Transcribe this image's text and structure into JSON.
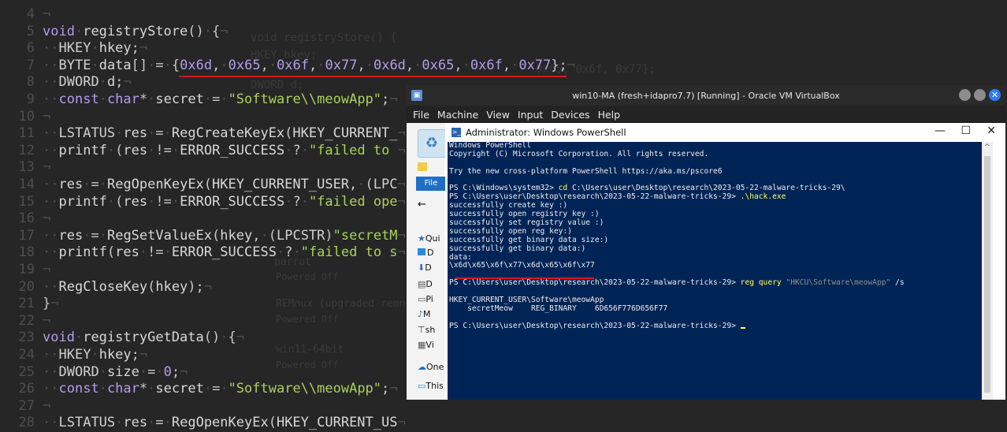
{
  "editor": {
    "lines": [
      {
        "n": "4",
        "code": ""
      },
      {
        "n": "5",
        "code": "void registryStore() {"
      },
      {
        "n": "6",
        "code": "  HKEY hkey;"
      },
      {
        "n": "7",
        "code": "  BYTE data[] = {0x6d, 0x65, 0x6f, 0x77, 0x6d, 0x65, 0x6f, 0x77};"
      },
      {
        "n": "8",
        "code": "  DWORD d;"
      },
      {
        "n": "9",
        "code": "  const char* secret = \"Software\\\\meowApp\";"
      },
      {
        "n": "10",
        "code": ""
      },
      {
        "n": "11",
        "code": "  LSTATUS res = RegCreateKeyEx(HKEY_CURRENT_"
      },
      {
        "n": "12",
        "code": "  printf (res != ERROR_SUCCESS ? \"failed to "
      },
      {
        "n": "13",
        "code": ""
      },
      {
        "n": "14",
        "code": "  res = RegOpenKeyEx(HKEY_CURRENT_USER, (LPC"
      },
      {
        "n": "15",
        "code": "  printf (res != ERROR_SUCCESS ? \"failed ope"
      },
      {
        "n": "16",
        "code": ""
      },
      {
        "n": "17",
        "code": "  res = RegSetValueEx(hkey, (LPCSTR)\"secretM"
      },
      {
        "n": "18",
        "code": "  printf(res != ERROR_SUCCESS ? \"failed to s"
      },
      {
        "n": "19",
        "code": ""
      },
      {
        "n": "20",
        "code": "  RegCloseKey(hkey);"
      },
      {
        "n": "21",
        "code": "}"
      },
      {
        "n": "22",
        "code": ""
      },
      {
        "n": "23",
        "code": "void registryGetData() {"
      },
      {
        "n": "24",
        "code": "  HKEY hkey;"
      },
      {
        "n": "25",
        "code": "  DWORD size = 0;"
      },
      {
        "n": "26",
        "code": "  const char* secret = \"Software\\\\meowApp\";"
      },
      {
        "n": "27",
        "code": ""
      },
      {
        "n": "28",
        "code": "  LSTATUS res = RegOpenKeyEx(HKEY_CURRENT_US"
      }
    ],
    "ghost": [
      {
        "text": "void registryStore() {"
      },
      {
        "text": "HKEY hkey;"
      },
      {
        "text": "0x65, 0x6f, 0x77};"
      },
      {
        "text": "DWORD d;"
      },
      {
        "text": "parrot"
      },
      {
        "text": "Powered Off"
      },
      {
        "text": "REMnux (upgraded remnux)"
      },
      {
        "text": "Powered Off"
      },
      {
        "text": "win11-64bit"
      },
      {
        "text": "Powered Off"
      }
    ]
  },
  "vbox": {
    "title": "win10-MA (fresh+idapro7.7) [Running] - Oracle VM VirtualBox",
    "menu": [
      "File",
      "Machine",
      "View",
      "Input",
      "Devices",
      "Help"
    ]
  },
  "explorer": {
    "file_tab": "File",
    "items": [
      "Qui",
      "D",
      "D",
      "D",
      "Pi",
      "M",
      "sh",
      "Vi",
      "One",
      "This"
    ]
  },
  "powershell": {
    "title": "Administrator: Windows PowerShell",
    "minimize": "—",
    "maximize": "☐",
    "close": "✕",
    "lines": [
      {
        "segs": [
          {
            "t": "Windows PowerShell",
            "c": "wh"
          }
        ]
      },
      {
        "segs": [
          {
            "t": "Copyright (C) Microsoft Corporation. All rights reserved.",
            "c": "wh"
          }
        ]
      },
      {
        "segs": [
          {
            "t": "",
            "c": "wh"
          }
        ]
      },
      {
        "segs": [
          {
            "t": "Try the new cross-platform PowerShell https://aka.ms/pscore6",
            "c": "wh"
          }
        ]
      },
      {
        "segs": [
          {
            "t": "",
            "c": "wh"
          }
        ]
      },
      {
        "segs": [
          {
            "t": "PS C:\\Windows\\system32> ",
            "c": "wh"
          },
          {
            "t": "cd",
            "c": "yel"
          },
          {
            "t": " C:\\Users\\user\\Desktop\\research\\2023-05-22-malware-tricks-29\\",
            "c": "wh"
          }
        ]
      },
      {
        "segs": [
          {
            "t": "PS C:\\Users\\user\\Desktop\\research\\2023-05-22-malware-tricks-29> ",
            "c": "wh"
          },
          {
            "t": ".\\hack.exe",
            "c": "yel"
          }
        ]
      },
      {
        "segs": [
          {
            "t": "successfully create key :)",
            "c": "wh"
          }
        ]
      },
      {
        "segs": [
          {
            "t": "successfully open registry key :)",
            "c": "wh"
          }
        ]
      },
      {
        "segs": [
          {
            "t": "successfully set registry value :)",
            "c": "wh"
          }
        ]
      },
      {
        "segs": [
          {
            "t": "successfully open reg key:)",
            "c": "wh"
          }
        ]
      },
      {
        "segs": [
          {
            "t": "successfully get binary data size:)",
            "c": "wh"
          }
        ]
      },
      {
        "segs": [
          {
            "t": "successfully get binary data:)",
            "c": "wh"
          }
        ]
      },
      {
        "segs": [
          {
            "t": "data:",
            "c": "wh"
          }
        ]
      },
      {
        "segs": [
          {
            "t": "\\x6d\\x65\\x6f\\x77\\x6d\\x65\\x6f\\x77",
            "c": "wh"
          }
        ]
      },
      {
        "segs": [
          {
            "t": "",
            "c": "wh"
          }
        ]
      },
      {
        "segs": [
          {
            "t": "PS C:\\Users\\user\\Desktop\\research\\2023-05-22-malware-tricks-29> ",
            "c": "wh"
          },
          {
            "t": "reg query",
            "c": "yel"
          },
          {
            "t": " \"HKCU\\Software\\meowApp\"",
            "c": "gry"
          },
          {
            "t": " /s",
            "c": "wh"
          }
        ]
      },
      {
        "segs": [
          {
            "t": "",
            "c": "wh"
          }
        ]
      },
      {
        "segs": [
          {
            "t": "HKEY_CURRENT_USER\\Software\\meowApp",
            "c": "wh"
          }
        ]
      },
      {
        "segs": [
          {
            "t": "    secretMeow    REG_BINARY    6D656F776D656F77",
            "c": "wh"
          }
        ]
      },
      {
        "segs": [
          {
            "t": "",
            "c": "wh"
          }
        ]
      },
      {
        "segs": [
          {
            "t": "PS C:\\Users\\user\\Desktop\\research\\2023-05-22-malware-tricks-29> ",
            "c": "wh"
          }
        ]
      }
    ]
  },
  "colors": {
    "editor_bg": "#262626",
    "console_bg": "#012456",
    "underline": "#d21a1a",
    "keyword": "#b59af0",
    "string": "#a8d35a"
  }
}
